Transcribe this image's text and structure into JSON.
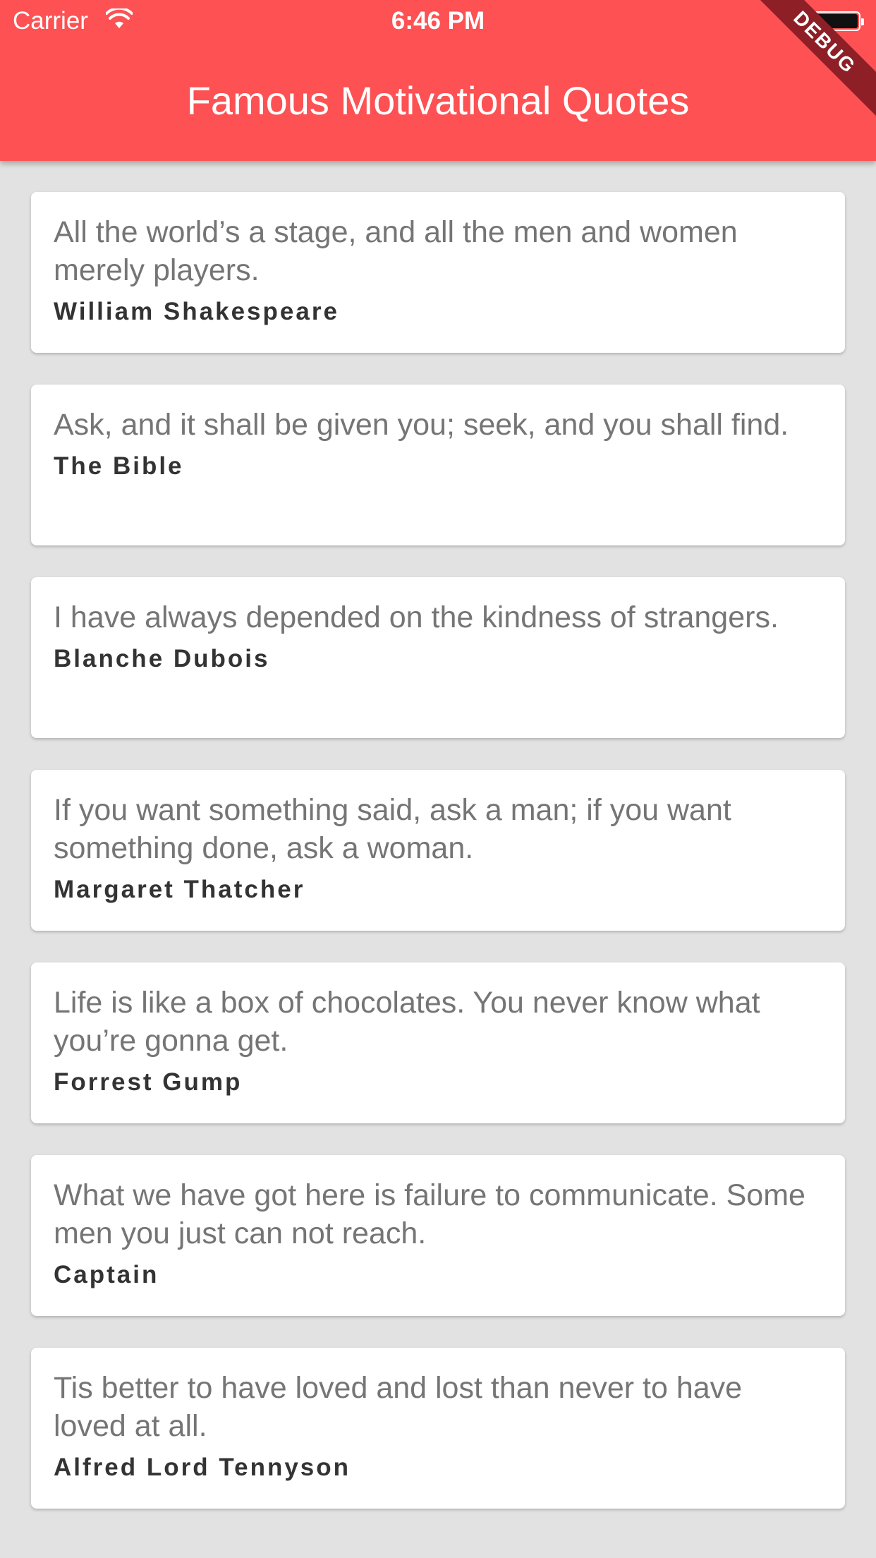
{
  "status_bar": {
    "carrier": "Carrier",
    "time": "6:46 PM",
    "wifi_icon": "wifi-icon",
    "battery_icon": "battery-icon"
  },
  "app_bar": {
    "title": "Famous Motivational Quotes",
    "debug_banner": "DEBUG",
    "color": "#fd5153"
  },
  "quotes": [
    {
      "text": "All the world’s a stage, and all the men and women merely players.",
      "author": "William Shakespeare"
    },
    {
      "text": "Ask, and it shall be given you; seek, and you shall find.",
      "author": "The Bible"
    },
    {
      "text": "I have always depended on the kindness of strangers.",
      "author": "Blanche Dubois"
    },
    {
      "text": "If you want something said, ask a man; if you want something done, ask a woman.",
      "author": "Margaret Thatcher"
    },
    {
      "text": "Life is like a box of chocolates. You never know what you’re gonna get.",
      "author": "Forrest Gump"
    },
    {
      "text": "What we have got here is failure to communicate. Some men you just can not reach.",
      "author": "Captain"
    },
    {
      "text": "Tis better to have loved and lost than never to have loved at all.",
      "author": "Alfred Lord Tennyson"
    }
  ]
}
